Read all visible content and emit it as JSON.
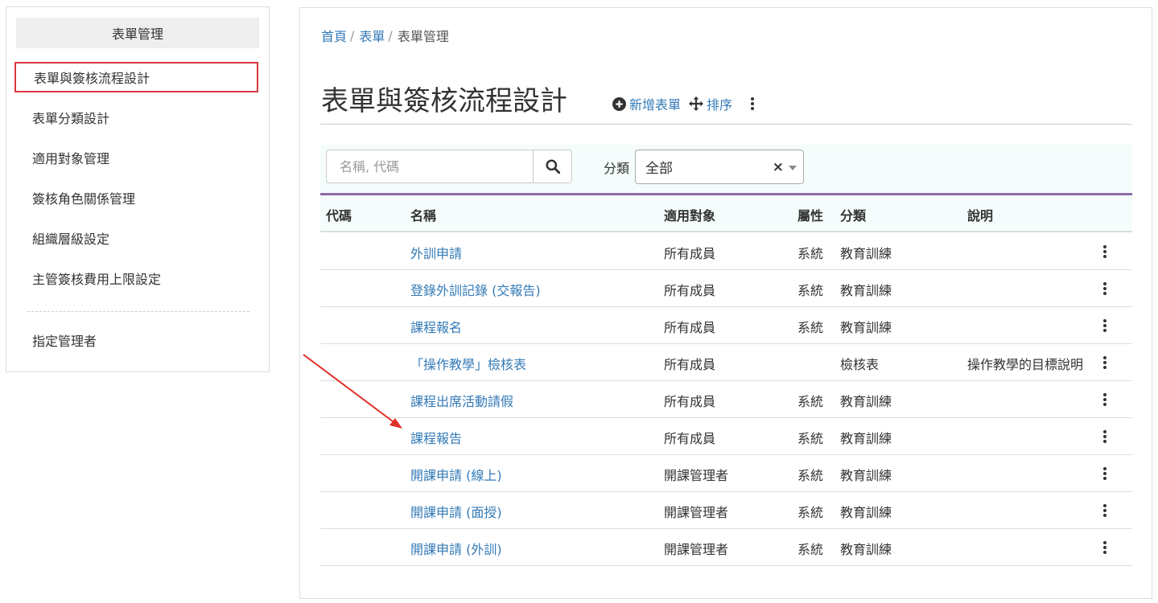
{
  "sidebar": {
    "title": "表單管理",
    "items": [
      {
        "label": "表單與簽核流程設計",
        "active": true
      },
      {
        "label": "表單分類設計"
      },
      {
        "label": "適用對象管理"
      },
      {
        "label": "簽核角色關係管理"
      },
      {
        "label": "組織層級設定"
      },
      {
        "label": "主管簽核費用上限設定"
      }
    ],
    "bottom_item": {
      "label": "指定管理者"
    }
  },
  "breadcrumb": {
    "home": "首頁",
    "forms": "表單",
    "current": "表單管理",
    "separator": "/"
  },
  "page": {
    "title": "表單與簽核流程設計",
    "add_label": "新增表單",
    "sort_label": "排序"
  },
  "filters": {
    "search_placeholder": "名稱, 代碼",
    "search_value": "",
    "category_label": "分類",
    "category_value": "全部",
    "clear_symbol": "×"
  },
  "table": {
    "headers": {
      "code": "代碼",
      "name": "名稱",
      "target": "適用對象",
      "attr": "屬性",
      "category": "分類",
      "desc": "說明"
    },
    "rows": [
      {
        "code": "",
        "name": "外訓申請",
        "target": "所有成員",
        "attr": "系統",
        "category": "教育訓練",
        "desc": ""
      },
      {
        "code": "",
        "name": "登錄外訓記錄 (交報告)",
        "target": "所有成員",
        "attr": "系統",
        "category": "教育訓練",
        "desc": ""
      },
      {
        "code": "",
        "name": "課程報名",
        "target": "所有成員",
        "attr": "系統",
        "category": "教育訓練",
        "desc": ""
      },
      {
        "code": "",
        "name": "「操作教學」檢核表",
        "target": "所有成員",
        "attr": "",
        "category": "檢核表",
        "desc": "操作教學的目標說明"
      },
      {
        "code": "",
        "name": "課程出席活動請假",
        "target": "所有成員",
        "attr": "系統",
        "category": "教育訓練",
        "desc": ""
      },
      {
        "code": "",
        "name": "課程報告",
        "target": "所有成員",
        "attr": "系統",
        "category": "教育訓練",
        "desc": ""
      },
      {
        "code": "",
        "name": "開課申請 (線上)",
        "target": "開課管理者",
        "attr": "系統",
        "category": "教育訓練",
        "desc": ""
      },
      {
        "code": "",
        "name": "開課申請 (面授)",
        "target": "開課管理者",
        "attr": "系統",
        "category": "教育訓練",
        "desc": ""
      },
      {
        "code": "",
        "name": "開課申請 (外訓)",
        "target": "開課管理者",
        "attr": "系統",
        "category": "教育訓練",
        "desc": ""
      }
    ]
  },
  "colors": {
    "link": "#337ab7",
    "highlight_box": "#d9363e",
    "header_rule": "#8e6ba8",
    "annotation_arrow": "#e0302a"
  },
  "icons": {
    "add": "plus-circle-icon",
    "sort": "move-arrows-icon",
    "more": "kebab-vertical-icon",
    "search": "search-icon"
  }
}
